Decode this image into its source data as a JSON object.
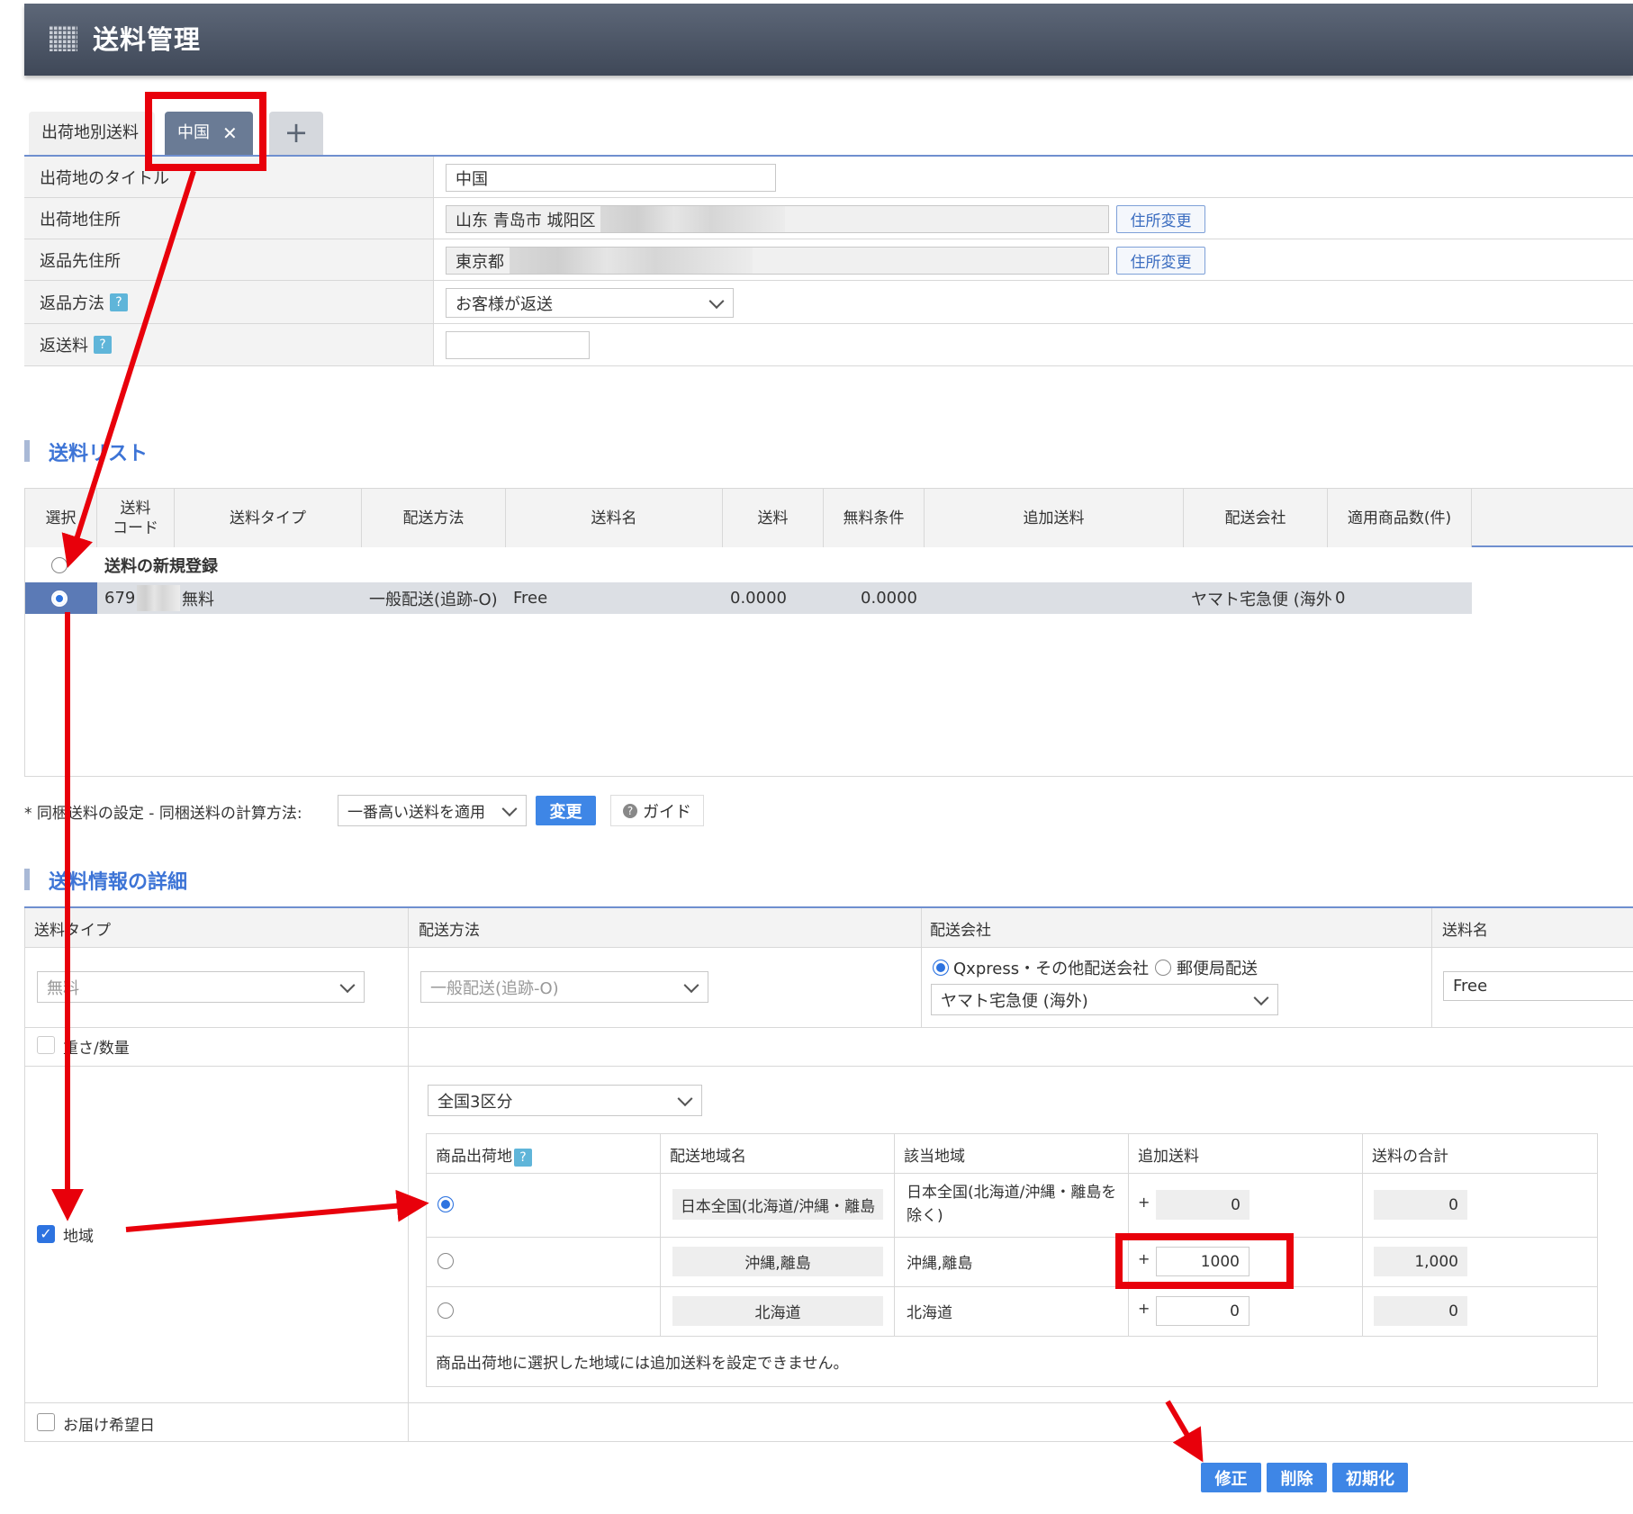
{
  "header": {
    "title": "送料管理"
  },
  "tabs": [
    {
      "label": "出荷地別送料"
    },
    {
      "label": "中国",
      "close": "✕"
    },
    {
      "label": "+"
    }
  ],
  "origin": {
    "title_label": "出荷地のタイトル",
    "title_value": "中国",
    "address_label": "出荷地住所",
    "address_value": "山东 青岛市 城阳区",
    "address_button": "住所変更",
    "return_label": "返品先住所",
    "return_value": "東京都",
    "return_button": "住所変更",
    "return_method_label": "返品方法",
    "return_method_value": "お客様が返送",
    "return_fee_label": "返送料",
    "return_fee_value": "",
    "help": "?"
  },
  "fee_list": {
    "heading": "送料リスト",
    "columns": [
      "選択",
      "送料\nコード",
      "送料タイプ",
      "配送方法",
      "送料名",
      "送料",
      "無料条件",
      "追加送料",
      "配送会社",
      "適用商品数(件)"
    ],
    "new_row": "送料の新規登録",
    "row": {
      "code": "679",
      "type": "無料",
      "method": "一般配送(追跡-O)",
      "name": "Free",
      "fee": "0.0000",
      "free_cond": "0.0000",
      "extra": "",
      "carrier": "ヤマト宅急便 (海外",
      "count": "0"
    }
  },
  "bundle": {
    "label": "* 同梱送料の設定 - 同梱送料の計算方法:",
    "select": "一番高い送料を適用",
    "change_button": "変更",
    "guide_button": "ガイド",
    "guide_icon": "?"
  },
  "detail": {
    "heading": "送料情報の詳細",
    "col_type": "送料タイプ",
    "col_method": "配送方法",
    "col_carrier": "配送会社",
    "col_name": "送料名",
    "type_value": "無料",
    "method_value": "一般配送(追跡-O)",
    "carrier_radio1": "Qxpress・その他配送会社",
    "carrier_radio2": "郵便局配送",
    "carrier_select": "ヤマト宅急便 (海外)",
    "name_value": "Free",
    "weight_label": "重さ/数量",
    "region_label": "地域",
    "region_select": "全国3区分",
    "region_cols": [
      "商品出荷地",
      "配送地域名",
      "該当地域",
      "追加送料",
      "送料の合計"
    ],
    "regions": [
      {
        "name": "日本全国(北海道/沖縄・離島",
        "area": "日本全国(北海道/沖縄・離島を除く)",
        "plus": "+",
        "extra": "0",
        "total": "0"
      },
      {
        "name": "沖縄,離島",
        "area": "沖縄,離島",
        "plus": "+",
        "extra": "1000",
        "total": "1,000"
      },
      {
        "name": "北海道",
        "area": "北海道",
        "plus": "+",
        "extra": "0",
        "total": "0"
      }
    ],
    "region_note": "商品出荷地に選択した地域には追加送料を設定できません。",
    "delivery_date_label": "お届け希望日"
  },
  "actions": {
    "edit": "修正",
    "delete": "削除",
    "reset": "初期化"
  },
  "colors": {
    "accent": "#3e86e6",
    "annotation": "#e8000b",
    "header_bg": "#4c5566"
  }
}
